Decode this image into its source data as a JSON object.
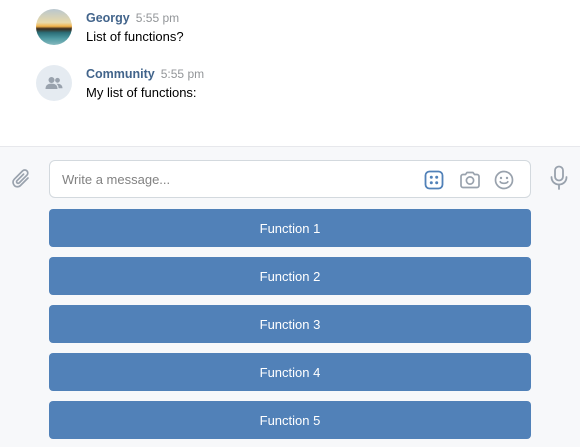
{
  "messages": [
    {
      "author": "Georgy",
      "time": "5:55 pm",
      "text": "List of functions?",
      "avatar": "sunset-photo"
    },
    {
      "author": "Community",
      "time": "5:55 pm",
      "text": "My list of functions:",
      "avatar": "community-icon"
    }
  ],
  "composer": {
    "placeholder": "Write a message...",
    "icons": [
      "paperclip-icon",
      "bot-keyboard-icon",
      "camera-icon",
      "smile-icon",
      "microphone-icon"
    ]
  },
  "keyboard": {
    "buttons": [
      "Function 1",
      "Function 2",
      "Function 3",
      "Function 4",
      "Function 5"
    ]
  },
  "colors": {
    "button": "#5181b8",
    "author": "#42648b",
    "accent_icon": "#5181b8",
    "muted_icon": "#99a2ad"
  }
}
